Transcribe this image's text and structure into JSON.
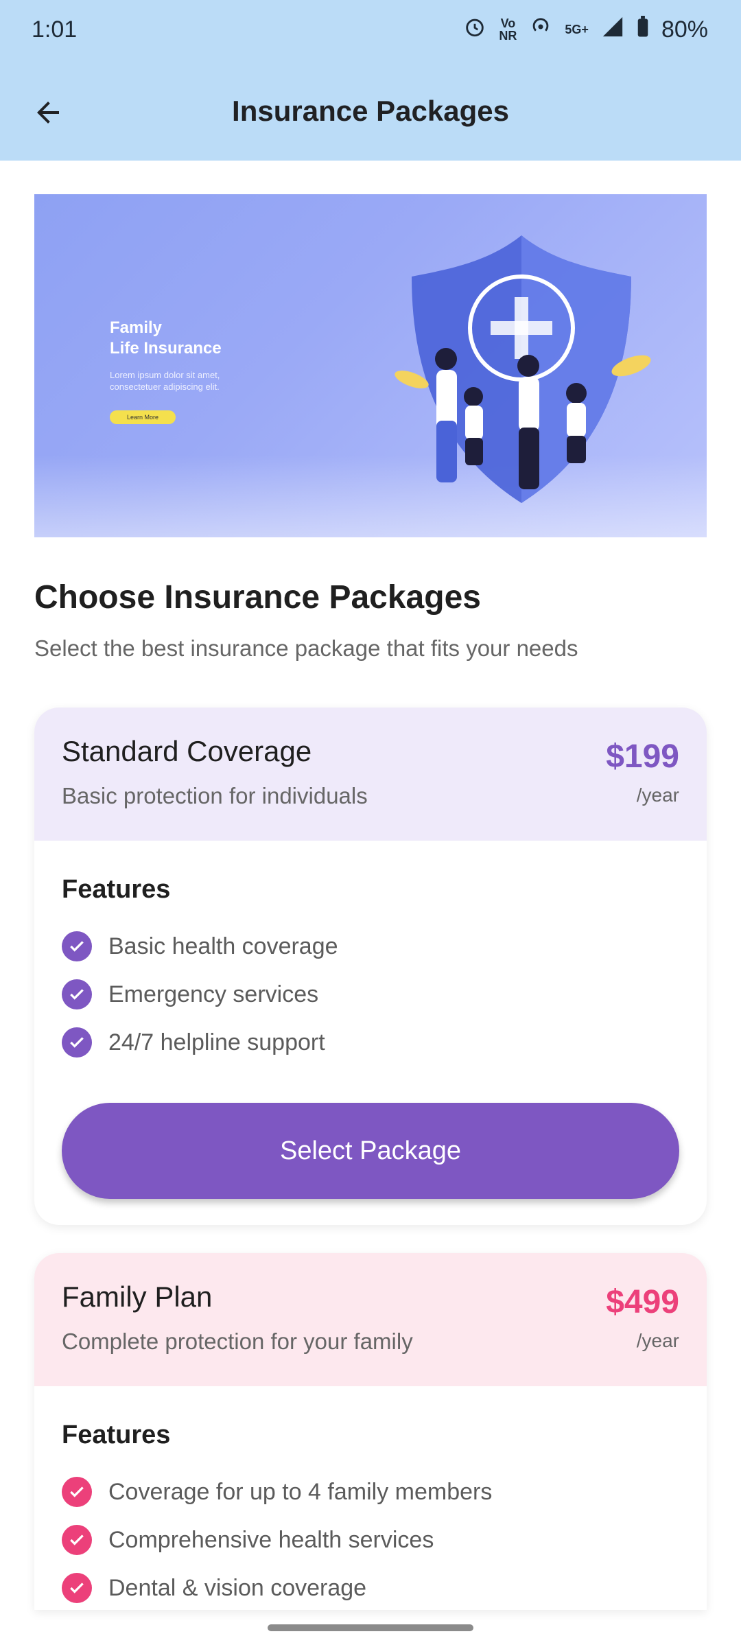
{
  "status_bar": {
    "time": "1:01",
    "volte_top": "Vo",
    "volte_bottom": "NR",
    "network": "5G+",
    "battery": "80%"
  },
  "app_bar": {
    "title": "Insurance Packages",
    "back_icon": "arrow-back-icon"
  },
  "hero": {
    "title_line1": "Family",
    "title_line2": "Life Insurance",
    "body": "Lorem ipsum dolor sit amet, consectetuer adipiscing elit.",
    "button": "Learn More"
  },
  "section": {
    "title": "Choose Insurance Packages",
    "subtitle": "Select the best insurance package that fits your needs"
  },
  "packages": [
    {
      "name": "Standard Coverage",
      "description": "Basic protection for individuals",
      "price": "$199",
      "period": "/year",
      "features_title": "Features",
      "features": [
        "Basic health coverage",
        "Emergency services",
        "24/7 helpline support"
      ],
      "button": "Select Package",
      "accent": "#7e57c2",
      "header_bg": "#efeafa"
    },
    {
      "name": "Family Plan",
      "description": "Complete protection for your family",
      "price": "$499",
      "period": "/year",
      "features_title": "Features",
      "features": [
        "Coverage for up to 4 family members",
        "Comprehensive health services",
        "Dental & vision coverage"
      ],
      "accent": "#ec407a",
      "header_bg": "#fde8ee"
    }
  ]
}
